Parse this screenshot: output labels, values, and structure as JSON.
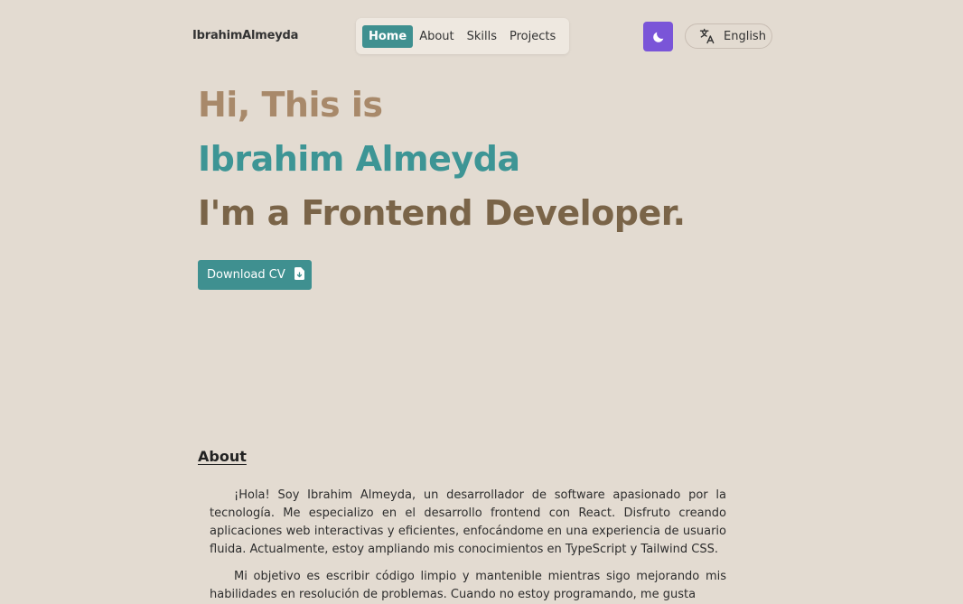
{
  "header": {
    "logo": "IbrahimAlmeyda",
    "nav": [
      {
        "label": "Home",
        "active": true
      },
      {
        "label": "About",
        "active": false
      },
      {
        "label": "Skills",
        "active": false
      },
      {
        "label": "Projects",
        "active": false
      }
    ],
    "theme_icon": "moon-icon",
    "language": {
      "icon": "translate-icon",
      "label": "English"
    }
  },
  "hero": {
    "line1": "Hi, This is",
    "line2": "Ibrahim Almeyda",
    "line3": "I'm a Frontend Developer.",
    "download_label": "Download CV",
    "download_icon": "file-download-icon"
  },
  "about": {
    "heading": "About",
    "paragraphs": [
      "¡Hola! Soy Ibrahim Almeyda, un desarrollador de software apasionado por la tecnología. Me especializo en el desarrollo frontend con React. Disfruto creando aplicaciones web interactivas y eficientes, enfocándome en una experiencia de usuario fluida. Actualmente, estoy ampliando mis conocimientos en TypeScript y Tailwind CSS.",
      "Mi objetivo es escribir código limpio y mantenible mientras sigo mejorando mis habilidades en resolución de problemas. Cuando no estoy programando, me gusta"
    ]
  },
  "colors": {
    "background": "#e3dbd1",
    "accent_teal": "#3f9090",
    "accent_purple": "#7a55d8",
    "hero_tan": "#a8896a",
    "hero_brown": "#7a6448"
  }
}
